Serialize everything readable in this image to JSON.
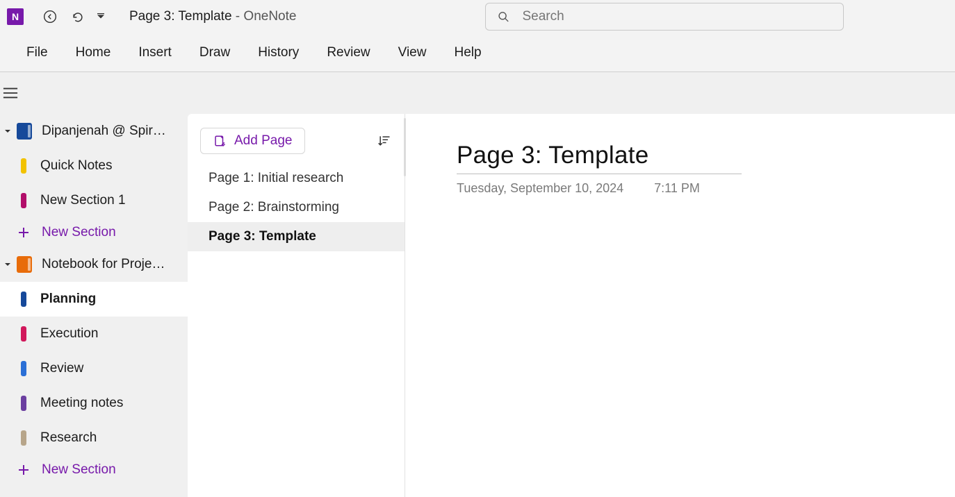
{
  "titlebar": {
    "page_title": "Page 3: Template",
    "separator": "  -  ",
    "app_name": "OneNote"
  },
  "search": {
    "placeholder": "Search"
  },
  "ribbon": {
    "tabs": [
      "File",
      "Home",
      "Insert",
      "Draw",
      "History",
      "Review",
      "View",
      "Help"
    ]
  },
  "notebooks": [
    {
      "name": "Dipanjenah @ Spiral...",
      "color": "blue",
      "expanded": true,
      "sections": [
        {
          "name": "Quick Notes",
          "tab_color": "#f2c200",
          "selected": false
        },
        {
          "name": "New Section 1",
          "tab_color": "#b20e6a",
          "selected": false
        }
      ]
    },
    {
      "name": "Notebook for Project A",
      "color": "orange",
      "expanded": true,
      "sections": [
        {
          "name": "Planning",
          "tab_color": "#16499a",
          "selected": true
        },
        {
          "name": "Execution",
          "tab_color": "#d1185b",
          "selected": false
        },
        {
          "name": "Review",
          "tab_color": "#2a6fd6",
          "selected": false
        },
        {
          "name": "Meeting notes",
          "tab_color": "#6b3fa0",
          "selected": false
        },
        {
          "name": "Research",
          "tab_color": "#b7a58a",
          "selected": false
        }
      ]
    }
  ],
  "new_section_label": "New Section",
  "pages_panel": {
    "add_page_label": "Add Page",
    "pages": [
      {
        "title": "Page 1: Initial research",
        "selected": false
      },
      {
        "title": "Page 2: Brainstorming",
        "selected": false
      },
      {
        "title": "Page 3: Template",
        "selected": true
      }
    ]
  },
  "content": {
    "title": "Page 3: Template",
    "date": "Tuesday, September 10, 2024",
    "time": "7:11 PM"
  }
}
